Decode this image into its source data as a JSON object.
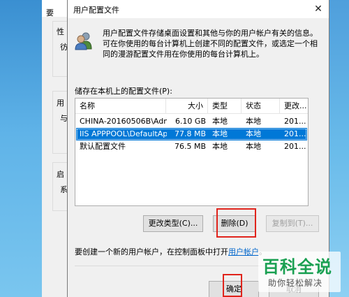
{
  "parent": {
    "title_fragment": "要",
    "group1": "性",
    "group1_sub": "彷",
    "group2": "用",
    "group2_sub": "与",
    "group3": "启",
    "group3_sub": "系"
  },
  "dialog": {
    "title": "用户配置文件",
    "close_glyph": "✕",
    "intro_text": "用户配置文件存储桌面设置和其他与你的用户帐户有关的信息。可在你使用的每台计算机上创建不同的配置文件，或选定一个相同的漫游配置文件用在你使用的每台计算机上。",
    "list_label": "储存在本机上的配置文件(P):",
    "columns": [
      "名称",
      "大小",
      "类型",
      "状态",
      "更改..."
    ],
    "rows": [
      {
        "name": "CHINA-20160506B\\Admi...",
        "size": "6.10 GB",
        "type": "本地",
        "status": "本地",
        "changed": "201..."
      },
      {
        "name": "IIS APPPOOL\\DefaultApp...",
        "size": "77.8 MB",
        "type": "本地",
        "status": "本地",
        "changed": "201..."
      },
      {
        "name": "默认配置文件",
        "size": "76.5 MB",
        "type": "本地",
        "status": "本地",
        "changed": "201..."
      }
    ],
    "btn_change_type": "更改类型(C)...",
    "btn_delete": "删除(D)",
    "btn_copy_to": "复制到(T)...",
    "create_text": "要创建一个新的用户帐户，在控制面板中打开",
    "create_link": "用户帐户",
    "create_suffix": "。",
    "btn_ok": "确定",
    "btn_cancel": "取消"
  },
  "watermark": {
    "title": "百科全说",
    "subtitle": "助你轻松解决"
  },
  "colors": {
    "selection": "#0078d7",
    "highlight_box": "#e0241c",
    "link": "#0066cc",
    "watermark_green": "#1aa052"
  }
}
